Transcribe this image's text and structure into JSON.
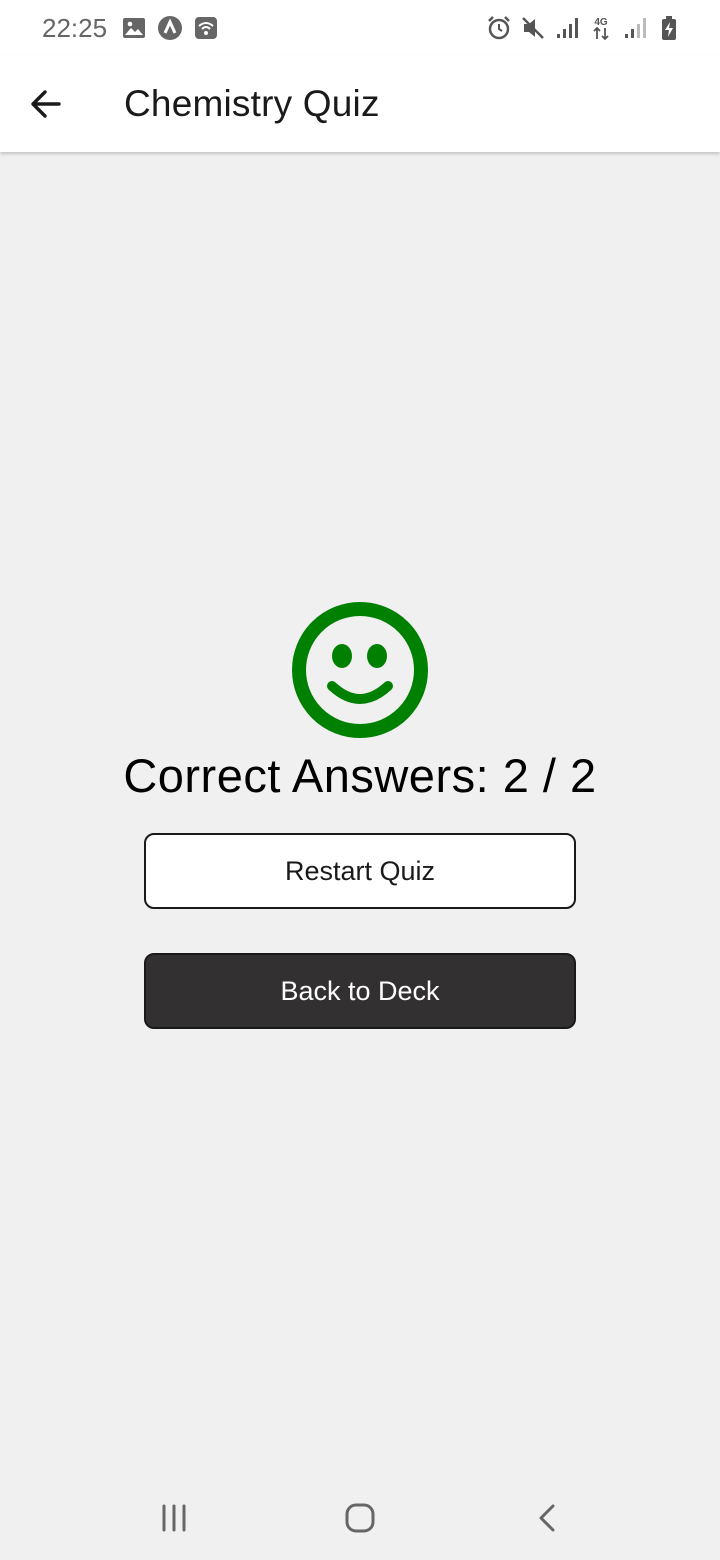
{
  "status_bar": {
    "time": "22:25",
    "left_icons": [
      "image-icon",
      "app-notification-icon",
      "wifi-calling-icon"
    ],
    "right_icons": [
      "alarm-icon",
      "mute-icon",
      "signal-icon",
      "4g-data-icon",
      "signal-weak-icon",
      "battery-charging-icon"
    ],
    "network_label": "4G"
  },
  "app_bar": {
    "title": "Chemistry Quiz",
    "back_icon": "arrow-left-icon"
  },
  "result": {
    "icon": "smiley-face-icon",
    "icon_color": "#008000",
    "score_text": "Correct Answers: 2 / 2"
  },
  "buttons": {
    "restart_label": "Restart Quiz",
    "back_label": "Back to Deck",
    "back_bg_color": "#323031"
  },
  "nav_bar": {
    "recents_icon": "recents-icon",
    "home_icon": "home-icon",
    "back_icon": "nav-back-icon"
  }
}
